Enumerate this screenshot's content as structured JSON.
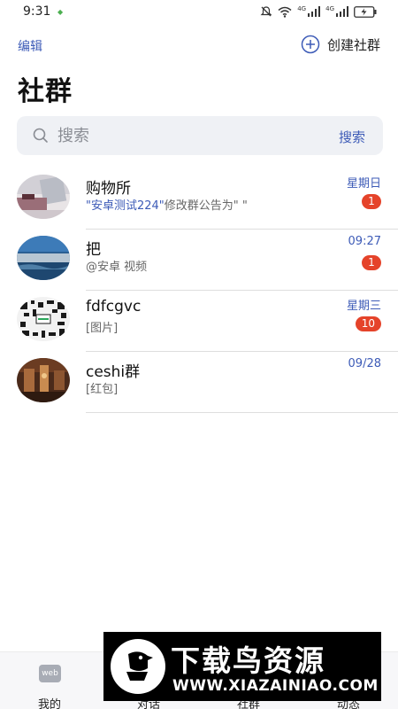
{
  "status_bar": {
    "time": "9:31",
    "net1": "4G",
    "net2": "4G",
    "icons": [
      "mute-icon",
      "wifi-icon",
      "signal-icon",
      "signal-icon",
      "battery-icon"
    ]
  },
  "header": {
    "edit_label": "编辑",
    "create_label": "创建社群",
    "title": "社群"
  },
  "search": {
    "placeholder": "搜索",
    "button_label": "搜索"
  },
  "communities": [
    {
      "name": "购物所",
      "preview_highlight": "\"安卓测试224\"",
      "preview_rest": "修改群公告为\" \"",
      "time": "星期日",
      "unread": "1"
    },
    {
      "name": "把",
      "preview_highlight": "",
      "preview_rest": "@安卓 视频",
      "time": "09:27",
      "unread": "1"
    },
    {
      "name": "fdfcgvc",
      "preview_highlight": "",
      "preview_rest": "[图片]",
      "time": "星期三",
      "unread": "10"
    },
    {
      "name": "ceshi群",
      "preview_highlight": "",
      "preview_rest": "[红包]",
      "time": "09/28",
      "unread": ""
    }
  ],
  "tabs": [
    {
      "label": "我的",
      "icon_text": "web"
    },
    {
      "label": "对话"
    },
    {
      "label": "社群"
    },
    {
      "label": "动态"
    }
  ],
  "watermark": {
    "title": "下载鸟资源",
    "url": "WWW.XIAZAINIAO.COM"
  },
  "colors": {
    "accent": "#3d5bb7",
    "badge": "#e5432a",
    "search_bg": "#eff1f5"
  }
}
